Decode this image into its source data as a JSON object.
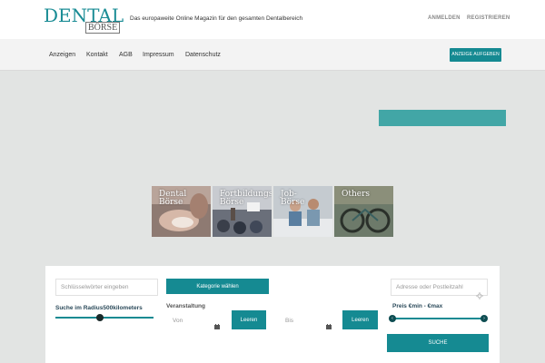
{
  "header": {
    "logo_main": "DENTAL",
    "logo_sub": "BÖRSE",
    "tagline": "Das europaweite Online Magazin für den gesamten Dentalbereich",
    "login": "ANMELDEN",
    "register": "REGISTRIEREN"
  },
  "nav": {
    "items": [
      "Anzeigen",
      "Kontakt",
      "AGB",
      "Impressum",
      "Datenschutz"
    ],
    "ad_button": "ANZEIGE AUFGEBEN"
  },
  "categories": [
    {
      "label_1": "Dental",
      "label_2": "Börse"
    },
    {
      "label_1": "Fortbildungs",
      "label_2": "Börse"
    },
    {
      "label_1": "Job-",
      "label_2": "Börse"
    },
    {
      "label_1": "Others",
      "label_2": ""
    }
  ],
  "search": {
    "keyword_placeholder": "Schlüsselwörter eingeben",
    "category_button": "Kategorie wählen",
    "address_placeholder": "Adresse oder Postleitzahl",
    "radius_label": "Suche im Radius500kilometers",
    "radius_level": 0.5,
    "event_label": "Veranstaltung",
    "from_placeholder": "Von",
    "to_placeholder": "Bis",
    "clear_label": "Leeren",
    "price_label": "Preis €min - €max",
    "search_button": "SUCHE"
  },
  "colors": {
    "accent": "#158a92",
    "hero_bar": "#42a6a6",
    "background": "#e2e4e3"
  }
}
